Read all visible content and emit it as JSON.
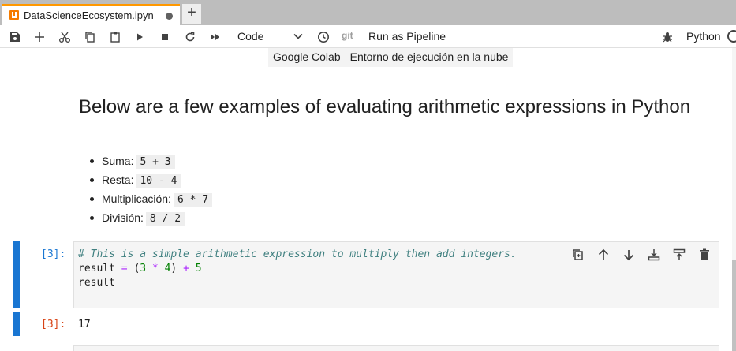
{
  "tabs": [
    {
      "title": "DataScienceEcosystem.ipyn",
      "dirty": true
    }
  ],
  "new_tab_label": "+",
  "toolbar": {
    "cell_type": "Code",
    "git_label": "git",
    "pipeline_label": "Run as Pipeline",
    "kernel_name": "Python"
  },
  "table_row": [
    "Google Colab",
    "Entorno de ejecución en la nube"
  ],
  "markdown": {
    "heading": "Below are a few examples of evaluating arithmetic expressions in Python",
    "items": [
      {
        "label": "Suma:",
        "code": "5 + 3"
      },
      {
        "label": "Resta:",
        "code": "10 - 4"
      },
      {
        "label": "Multiplicación:",
        "code": "6 * 7"
      },
      {
        "label": "División:",
        "code": "8 / 2"
      }
    ]
  },
  "code_cell": {
    "prompt": "[3]:",
    "comment": "# This is a simple arithmetic expression to multiply then add integers.",
    "line2": {
      "var": "result ",
      "eq": "=",
      "open": " (",
      "n1": "3",
      "mul": " * ",
      "n2": "4",
      "close": ") ",
      "plus": "+",
      "n3": " 5"
    },
    "line3": "result"
  },
  "output_cell": {
    "prompt": "[3]:",
    "value": "17"
  },
  "colors": {
    "accent": "#1976d2",
    "tab_indicator": "#ff9800",
    "output_prompt": "#d84315",
    "input_prompt": "#1976d2"
  },
  "icons": {
    "toolbar": [
      "save-icon",
      "add-cell-icon",
      "cut-icon",
      "copy-icon",
      "paste-icon",
      "run-icon",
      "stop-icon",
      "restart-icon",
      "fast-forward-icon",
      "clock-icon",
      "bug-icon"
    ],
    "cell_actions": [
      "duplicate-icon",
      "move-up-icon",
      "move-down-icon",
      "insert-below-icon",
      "insert-above-icon",
      "delete-icon"
    ]
  }
}
